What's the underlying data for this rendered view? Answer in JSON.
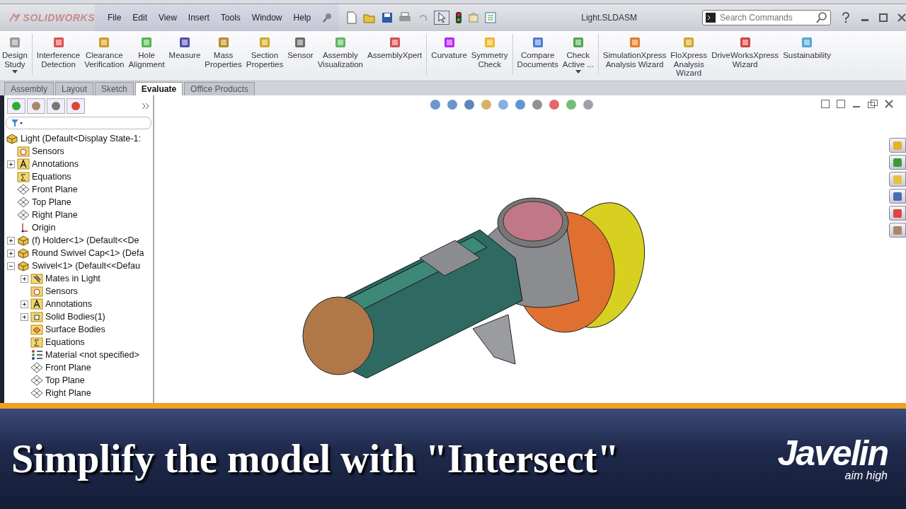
{
  "title_bar": {
    "brand": "SOLIDWORKS",
    "menu": [
      "File",
      "Edit",
      "View",
      "Insert",
      "Tools",
      "Window",
      "Help"
    ],
    "document_title": "Light.SLDASM",
    "search": {
      "placeholder": "Search Commands"
    }
  },
  "ribbon": {
    "commands": [
      {
        "label": "Design\nStudy",
        "dropdown": true
      },
      {
        "label": "Interference\nDetection",
        "dropdown": false
      },
      {
        "label": "Clearance\nVerification",
        "dropdown": false
      },
      {
        "label": "Hole\nAlignment",
        "dropdown": false
      },
      {
        "label": "Measure",
        "dropdown": false
      },
      {
        "label": "Mass\nProperties",
        "dropdown": false
      },
      {
        "label": "Section\nProperties",
        "dropdown": false
      },
      {
        "label": "Sensor",
        "dropdown": false
      },
      {
        "label": "Assembly\nVisualization",
        "dropdown": false
      },
      {
        "label": "AssemblyXpert",
        "dropdown": false
      },
      {
        "label": "Curvature",
        "dropdown": false
      },
      {
        "label": "Symmetry\nCheck",
        "dropdown": false
      },
      {
        "label": "Compare\nDocuments",
        "dropdown": false
      },
      {
        "label": "Check\nActive ...",
        "dropdown": true
      },
      {
        "label": "SimulationXpress\nAnalysis Wizard",
        "dropdown": false
      },
      {
        "label": "FloXpress\nAnalysis\nWizard",
        "dropdown": false
      },
      {
        "label": "DriveWorksXpress\nWizard",
        "dropdown": false
      },
      {
        "label": "Sustainability",
        "dropdown": false
      }
    ]
  },
  "tabs": [
    {
      "label": "Assembly",
      "selected": false
    },
    {
      "label": "Layout",
      "selected": false
    },
    {
      "label": "Sketch",
      "selected": false
    },
    {
      "label": "Evaluate",
      "selected": true
    },
    {
      "label": "Office Products",
      "selected": false
    }
  ],
  "feature_tree": {
    "root": {
      "label": "Light  (Default<Display State-1:",
      "kind": "assembly",
      "children": [
        {
          "label": "Sensors",
          "kind": "sensors"
        },
        {
          "label": "Annotations",
          "kind": "annotations",
          "expanded": false
        },
        {
          "label": "Equations",
          "kind": "equations"
        },
        {
          "label": "Front Plane",
          "kind": "plane"
        },
        {
          "label": "Top Plane",
          "kind": "plane"
        },
        {
          "label": "Right Plane",
          "kind": "plane"
        },
        {
          "label": "Origin",
          "kind": "origin"
        },
        {
          "label": "(f) Holder<1> (Default<<De",
          "kind": "part",
          "expanded": false
        },
        {
          "label": "Round Swivel Cap<1> (Defa",
          "kind": "part",
          "expanded": false
        },
        {
          "label": "Swivel<1> (Default<<Defau",
          "kind": "part",
          "expanded": true,
          "children": [
            {
              "label": "Mates in Light",
              "kind": "mates",
              "expanded": false
            },
            {
              "label": "Sensors",
              "kind": "sensors"
            },
            {
              "label": "Annotations",
              "kind": "annotations",
              "expanded": false
            },
            {
              "label": "Solid Bodies(1)",
              "kind": "solid",
              "expanded": false
            },
            {
              "label": "Surface Bodies",
              "kind": "surface"
            },
            {
              "label": "Equations",
              "kind": "equations"
            },
            {
              "label": "Material <not specified>",
              "kind": "material"
            },
            {
              "label": "Front Plane",
              "kind": "plane"
            },
            {
              "label": "Top Plane",
              "kind": "plane"
            },
            {
              "label": "Right Plane",
              "kind": "plane"
            }
          ]
        }
      ]
    }
  },
  "banner": {
    "caption": "Simplify the model with \"Intersect\"",
    "logo": "Javelin",
    "tagline": "aim high"
  }
}
